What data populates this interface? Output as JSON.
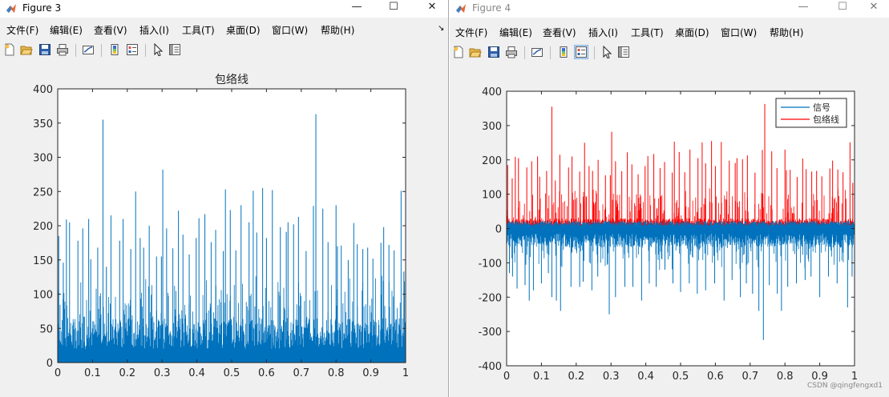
{
  "menu_labels": [
    "文件(F)",
    "编辑(E)",
    "查看(V)",
    "插入(I)",
    "工具(T)",
    "桌面(D)",
    "窗口(W)",
    "帮助(H)"
  ],
  "window_controls": {
    "minimize": "—",
    "maximize": "☐",
    "close": "✕"
  },
  "fig3": {
    "title": "Figure 3",
    "dock_arrow": "↘",
    "chart_data": {
      "type": "line",
      "title": "包络线",
      "xlabel": "",
      "ylabel": "",
      "xlim": [
        0,
        1
      ],
      "ylim": [
        0,
        400
      ],
      "xticks": [
        0,
        0.1,
        0.2,
        0.3,
        0.4,
        0.5,
        0.6,
        0.7,
        0.8,
        0.9,
        1
      ],
      "xtick_labels": [
        "0",
        "0.1",
        "0.2",
        "0.3",
        "0.4",
        "0.5",
        "0.6",
        "0.7",
        "0.8",
        "0.9",
        "1"
      ],
      "yticks": [
        0,
        50,
        100,
        150,
        200,
        250,
        300,
        350,
        400
      ],
      "ytick_labels": [
        "0",
        "50",
        "100",
        "150",
        "200",
        "250",
        "300",
        "350",
        "400"
      ],
      "grid": false,
      "series": [
        {
          "color": "#0072BD",
          "x": [
            0.003,
            0.016,
            0.025,
            0.034,
            0.058,
            0.072,
            0.089,
            0.095,
            0.115,
            0.13,
            0.14,
            0.153,
            0.178,
            0.188,
            0.21,
            0.224,
            0.237,
            0.247,
            0.263,
            0.284,
            0.298,
            0.302,
            0.313,
            0.331,
            0.347,
            0.36,
            0.378,
            0.398,
            0.406,
            0.423,
            0.441,
            0.454,
            0.476,
            0.482,
            0.496,
            0.512,
            0.527,
            0.55,
            0.562,
            0.572,
            0.589,
            0.6,
            0.617,
            0.64,
            0.657,
            0.662,
            0.678,
            0.692,
            0.714,
            0.735,
            0.742,
            0.762,
            0.777,
            0.8,
            0.804,
            0.815,
            0.835,
            0.851,
            0.861,
            0.877,
            0.891,
            0.906,
            0.929,
            0.937,
            0.952,
            0.967,
            0.987,
            0.995
          ],
          "y": [
            185,
            146,
            209,
            205,
            178,
            196,
            210,
            151,
            168,
            355,
            140,
            215,
            178,
            210,
            166,
            250,
            182,
            168,
            200,
            155,
            155,
            282,
            196,
            167,
            222,
            187,
            158,
            182,
            211,
            217,
            176,
            194,
            163,
            253,
            223,
            164,
            230,
            205,
            251,
            190,
            255,
            182,
            252,
            198,
            191,
            205,
            202,
            213,
            163,
            229,
            363,
            225,
            176,
            230,
            170,
            171,
            150,
            204,
            173,
            166,
            168,
            152,
            175,
            198,
            172,
            164,
            251,
            133
          ]
        }
      ]
    }
  },
  "fig4": {
    "title": "Figure 4",
    "chart_data": {
      "type": "line",
      "title": "",
      "xlabel": "",
      "ylabel": "",
      "xlim": [
        0,
        1
      ],
      "ylim": [
        -400,
        400
      ],
      "xticks": [
        0,
        0.1,
        0.2,
        0.3,
        0.4,
        0.5,
        0.6,
        0.7,
        0.8,
        0.9,
        1
      ],
      "xtick_labels": [
        "0",
        "0.1",
        "0.2",
        "0.3",
        "0.4",
        "0.5",
        "0.6",
        "0.7",
        "0.8",
        "0.9",
        "1"
      ],
      "yticks": [
        -400,
        -300,
        -200,
        -100,
        0,
        100,
        200,
        300,
        400
      ],
      "ytick_labels": [
        "-400",
        "-300",
        "-200",
        "-100",
        "0",
        "100",
        "200",
        "300",
        "400"
      ],
      "grid": false,
      "legend_position": "top-right",
      "series": [
        {
          "name": "信号",
          "color": "#0072BD",
          "x": [
            0.008,
            0.017,
            0.03,
            0.053,
            0.065,
            0.077,
            0.1,
            0.12,
            0.13,
            0.143,
            0.155,
            0.185,
            0.21,
            0.22,
            0.245,
            0.262,
            0.295,
            0.313,
            0.34,
            0.363,
            0.388,
            0.41,
            0.43,
            0.455,
            0.478,
            0.5,
            0.525,
            0.548,
            0.572,
            0.598,
            0.625,
            0.648,
            0.672,
            0.689,
            0.707,
            0.725,
            0.738,
            0.755,
            0.778,
            0.79,
            0.808,
            0.833,
            0.858,
            0.875,
            0.9,
            0.925,
            0.95,
            0.98,
            0.993
          ],
          "y": [
            -130,
            -140,
            -175,
            -165,
            -210,
            -180,
            -160,
            -130,
            -200,
            -210,
            -240,
            -170,
            -170,
            -155,
            -180,
            -140,
            -250,
            -200,
            -170,
            -170,
            -210,
            -160,
            -170,
            -120,
            -160,
            -185,
            -160,
            -190,
            -180,
            -160,
            -210,
            -150,
            -200,
            -160,
            -190,
            -240,
            -325,
            -165,
            -190,
            -240,
            -170,
            -160,
            -150,
            -140,
            -200,
            -140,
            -160,
            -230,
            -140
          ]
        },
        {
          "name": "包络线",
          "color": "#FF0000",
          "x": [
            0.003,
            0.016,
            0.025,
            0.034,
            0.058,
            0.072,
            0.089,
            0.095,
            0.115,
            0.13,
            0.14,
            0.153,
            0.178,
            0.188,
            0.21,
            0.224,
            0.237,
            0.247,
            0.263,
            0.284,
            0.298,
            0.302,
            0.313,
            0.331,
            0.347,
            0.36,
            0.378,
            0.398,
            0.406,
            0.423,
            0.441,
            0.454,
            0.476,
            0.482,
            0.496,
            0.512,
            0.527,
            0.55,
            0.562,
            0.572,
            0.589,
            0.6,
            0.617,
            0.64,
            0.657,
            0.662,
            0.678,
            0.692,
            0.714,
            0.735,
            0.742,
            0.762,
            0.777,
            0.8,
            0.804,
            0.815,
            0.835,
            0.851,
            0.861,
            0.877,
            0.891,
            0.906,
            0.929,
            0.937,
            0.952,
            0.967,
            0.987,
            0.995
          ],
          "y": [
            185,
            146,
            209,
            205,
            178,
            196,
            210,
            151,
            168,
            355,
            140,
            215,
            178,
            210,
            166,
            250,
            182,
            168,
            200,
            155,
            155,
            282,
            196,
            167,
            222,
            187,
            158,
            182,
            211,
            217,
            176,
            194,
            163,
            253,
            223,
            164,
            230,
            205,
            251,
            190,
            255,
            182,
            252,
            198,
            191,
            205,
            202,
            213,
            163,
            229,
            363,
            225,
            176,
            230,
            170,
            171,
            150,
            204,
            173,
            166,
            168,
            152,
            175,
            198,
            172,
            164,
            251,
            133
          ]
        }
      ]
    }
  },
  "watermark": "CSDN @qingfengxd1"
}
